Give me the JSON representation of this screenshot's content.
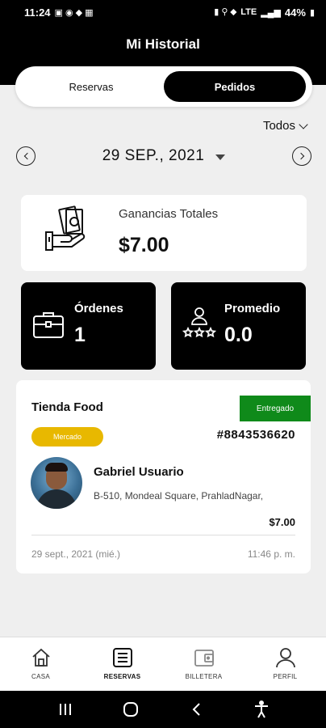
{
  "status_bar": {
    "time": "11:24",
    "battery": "44%",
    "signal_text": "LTE"
  },
  "header": {
    "title": "Mi Historial"
  },
  "tabs": [
    {
      "label": "Reservas",
      "active": false
    },
    {
      "label": "Pedidos",
      "active": true
    }
  ],
  "filter": {
    "label": "Todos"
  },
  "date_selector": {
    "date": "29 SEP., 2021"
  },
  "earnings": {
    "label": "Ganancias Totales",
    "value": "$7.00"
  },
  "stats": {
    "orders": {
      "label": "Órdenes",
      "value": "1"
    },
    "rating": {
      "label": "Promedio",
      "value": "0.0"
    }
  },
  "order": {
    "store_name": "Tienda Food",
    "status": "Entregado",
    "status_color": "#0f8a1a",
    "category": "Mercado",
    "category_color": "#e8b800",
    "order_id": "#8843536620",
    "customer_name": "Gabriel Usuario",
    "address": "B-510, Mondeal Square, PrahladNagar,",
    "amount": "$7.00",
    "date": "29 sept., 2021 (mié.)",
    "time": "11:46 p. m."
  },
  "bottom_nav": [
    {
      "label": "CASA",
      "icon": "home-icon",
      "active": false
    },
    {
      "label": "RESERVAS",
      "icon": "list-icon",
      "active": true
    },
    {
      "label": "BILLETERA",
      "icon": "wallet-icon",
      "active": false
    },
    {
      "label": "PERFIL",
      "icon": "profile-icon",
      "active": false
    }
  ]
}
